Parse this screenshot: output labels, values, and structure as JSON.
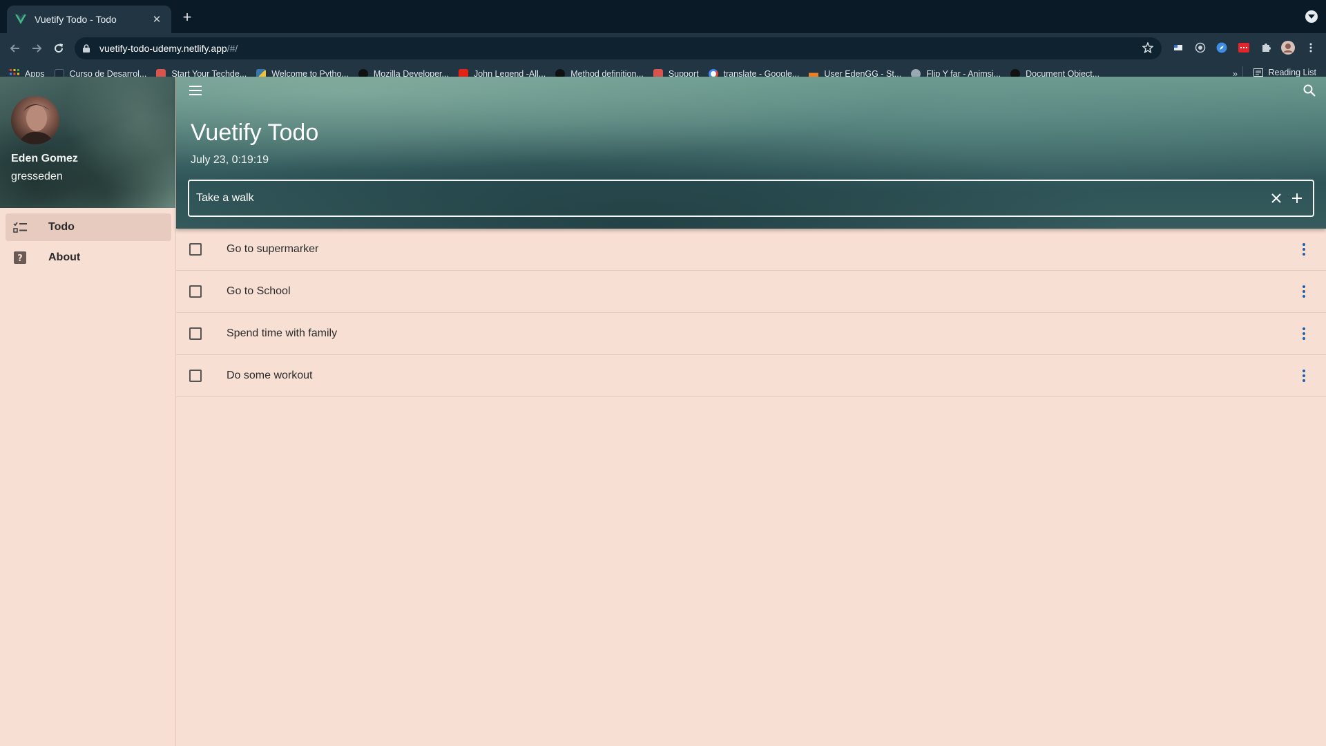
{
  "browser": {
    "tab_title": "Vuetify Todo - Todo",
    "url_host": "vuetify-todo-udemy.netlify.app",
    "url_path": "/#/",
    "bookmarks": [
      {
        "label": "Apps",
        "icon": "apps-grid-icon",
        "color": "#4a90e2"
      },
      {
        "label": "Curso de Desarrol...",
        "icon": "course-icon",
        "color": "#1c2b3a"
      },
      {
        "label": "Start Your Techde...",
        "icon": "calendar-icon",
        "color": "#d9534f"
      },
      {
        "label": "Welcome to Pytho...",
        "icon": "python-icon",
        "color": "#f2c230"
      },
      {
        "label": "Mozilla Developer...",
        "icon": "mdn-icon",
        "color": "#111111"
      },
      {
        "label": "John Legend -All...",
        "icon": "youtube-icon",
        "color": "#e62117"
      },
      {
        "label": "Method definition...",
        "icon": "mdn-icon",
        "color": "#111111"
      },
      {
        "label": "Support",
        "icon": "calendar-icon",
        "color": "#d9534f"
      },
      {
        "label": "translate - Google...",
        "icon": "google-icon",
        "color": "#ffffff"
      },
      {
        "label": "User EdenGG - St...",
        "icon": "stackoverflow-icon",
        "color": "#f48024"
      },
      {
        "label": "Flip Y far - Animsi...",
        "icon": "globe-icon",
        "color": "#9aa9b4"
      },
      {
        "label": "Document Object...",
        "icon": "mdn-icon",
        "color": "#111111"
      }
    ],
    "reading_list": "Reading List"
  },
  "drawer": {
    "user_name": "Eden Gomez",
    "user_handle": "gresseden",
    "nav": [
      {
        "label": "Todo",
        "icon": "format-list-checks-icon",
        "active": true
      },
      {
        "label": "About",
        "icon": "help-box-icon",
        "active": false
      }
    ]
  },
  "header": {
    "title": "Vuetify Todo",
    "date": "July 23, 0:19:19",
    "input_value": "Take a walk"
  },
  "todos": [
    {
      "title": "Go to supermarker",
      "done": false
    },
    {
      "title": "Go to School",
      "done": false
    },
    {
      "title": "Spend time with family",
      "done": false
    },
    {
      "title": "Do some workout",
      "done": false
    }
  ],
  "colors": {
    "page_bg": "#f8dfd4",
    "accent_menu_dots": "#1f5fa8",
    "active_nav": "#e7cbbf"
  }
}
